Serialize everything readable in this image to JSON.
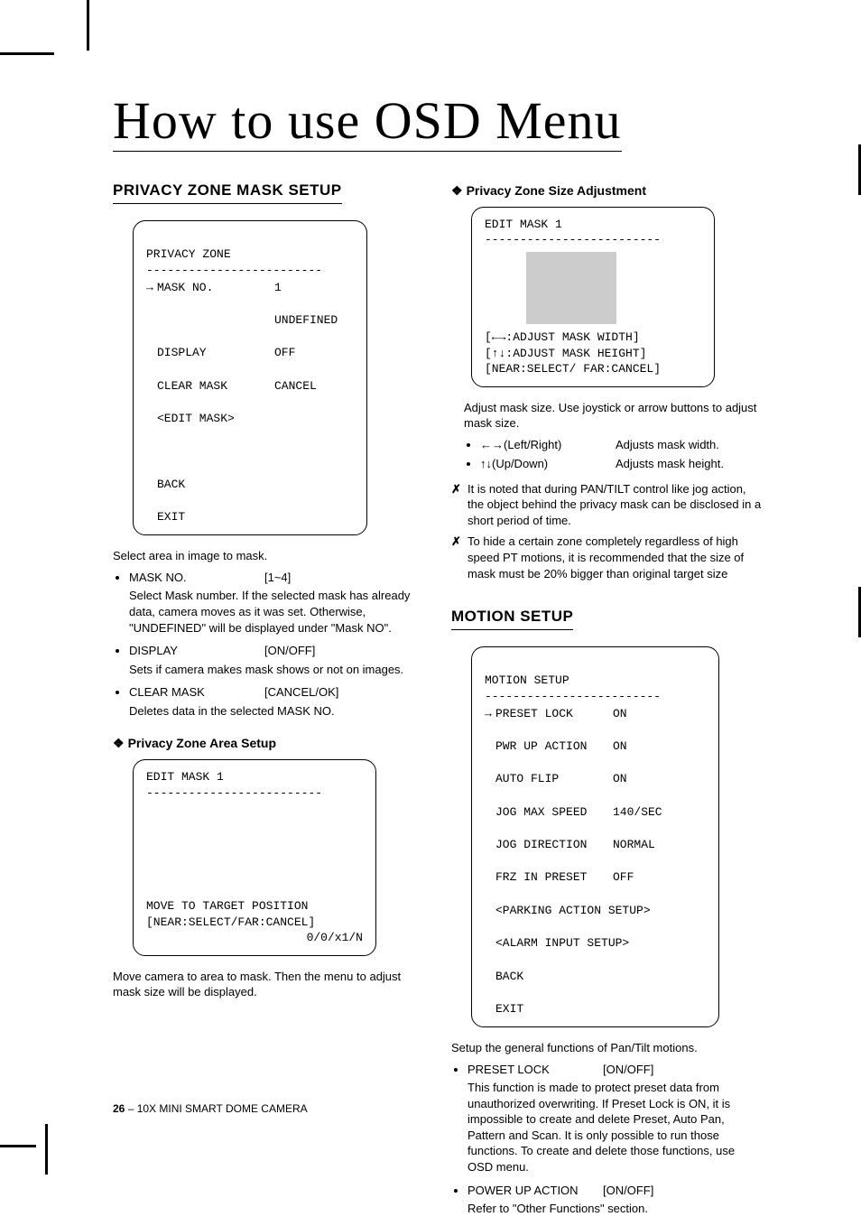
{
  "title": "How to use OSD Menu",
  "left": {
    "h_privacy": "PRIVACY ZONE MASK SETUP",
    "osd1": {
      "title": "PRIVACY ZONE",
      "dash": "-------------------------",
      "rows": [
        {
          "arrow": "→",
          "k": "MASK NO.",
          "v": "1"
        },
        {
          "arrow": "",
          "k": "",
          "v": "UNDEFINED"
        },
        {
          "arrow": "",
          "k": "DISPLAY",
          "v": "OFF"
        },
        {
          "arrow": "",
          "k": "CLEAR MASK",
          "v": "CANCEL"
        },
        {
          "arrow": "",
          "k": "<EDIT MASK>",
          "v": ""
        }
      ],
      "tail": [
        "BACK",
        "EXIT"
      ]
    },
    "p_select": "Select area in image to mask.",
    "b1_k": "MASK NO.",
    "b1_v": "[1~4]",
    "b1_d": "Select Mask number. If the selected mask has already data, camera moves as it was set. Otherwise, \"UNDEFINED\" will be displayed under \"Mask NO\".",
    "b2_k": "DISPLAY",
    "b2_v": "[ON/OFF]",
    "b2_d": "Sets if camera makes mask shows or not on images.",
    "b3_k": "CLEAR MASK",
    "b3_v": "[CANCEL/OK]",
    "b3_d": "Deletes data in the selected MASK NO.",
    "sub_area": "Privacy Zone Area Setup",
    "osd2": {
      "title": "EDIT MASK 1",
      "dash": "-------------------------",
      "l1": "MOVE TO TARGET POSITION",
      "l2": "[NEAR:SELECT/FAR:CANCEL]",
      "l3": "0/0/x1/N"
    },
    "p_move": "Move camera to area to mask. Then the menu to adjust mask size will be displayed."
  },
  "right": {
    "sub_size": "Privacy Zone Size Adjustment",
    "osd3": {
      "title": "EDIT MASK 1",
      "dash": "-------------------------",
      "l1": "[←→:ADJUST MASK WIDTH]",
      "l2": "[↑↓:ADJUST MASK HEIGHT]",
      "l3": "[NEAR:SELECT/ FAR:CANCEL]"
    },
    "p_adj": "Adjust mask size. Use joystick or arrow buttons to adjust mask size.",
    "adj1_k": "←→(Left/Right)",
    "adj1_v": "Adjusts mask width.",
    "adj2_k": "↑↓(Up/Down)",
    "adj2_v": "Adjusts mask height.",
    "note1": "It is noted that during PAN/TILT control like jog action, the object behind the privacy mask can be disclosed in a short period of time.",
    "note2": "To hide a certain zone completely regardless of high speed PT motions, it is recommended that the size of mask must be 20% bigger than original target size",
    "h_motion": "MOTION SETUP",
    "osd4": {
      "title": "MOTION SETUP",
      "dash": "-------------------------",
      "rows": [
        {
          "arrow": "→",
          "k": "PRESET LOCK",
          "v": "ON"
        },
        {
          "arrow": "",
          "k": "PWR UP ACTION",
          "v": "ON"
        },
        {
          "arrow": "",
          "k": "AUTO FLIP",
          "v": "ON"
        },
        {
          "arrow": "",
          "k": "JOG MAX SPEED",
          "v": "140/SEC"
        },
        {
          "arrow": "",
          "k": "JOG DIRECTION",
          "v": "NORMAL"
        },
        {
          "arrow": "",
          "k": "FRZ IN PRESET",
          "v": "OFF"
        },
        {
          "arrow": "",
          "k": "<PARKING ACTION SETUP>",
          "v": ""
        },
        {
          "arrow": "",
          "k": "<ALARM INPUT SETUP>",
          "v": ""
        },
        {
          "arrow": "",
          "k": "BACK",
          "v": ""
        },
        {
          "arrow": "",
          "k": "EXIT",
          "v": ""
        }
      ]
    },
    "p_motion": "Setup the general functions of Pan/Tilt motions.",
    "m1_k": "PRESET LOCK",
    "m1_v": "[ON/OFF]",
    "m1_d": "This function is made to protect preset data from unauthorized overwriting. If Preset Lock is ON, it is impossible to create and delete Preset, Auto Pan, Pattern and Scan. It is only possible to run those functions. To create and delete those functions, use OSD menu.",
    "m2_k": "POWER UP ACTION",
    "m2_v": "[ON/OFF]",
    "m2_d": "Refer to \"Other Functions\" section."
  },
  "footer_page": "26",
  "footer_text": " – 10X MINI SMART DOME CAMERA"
}
